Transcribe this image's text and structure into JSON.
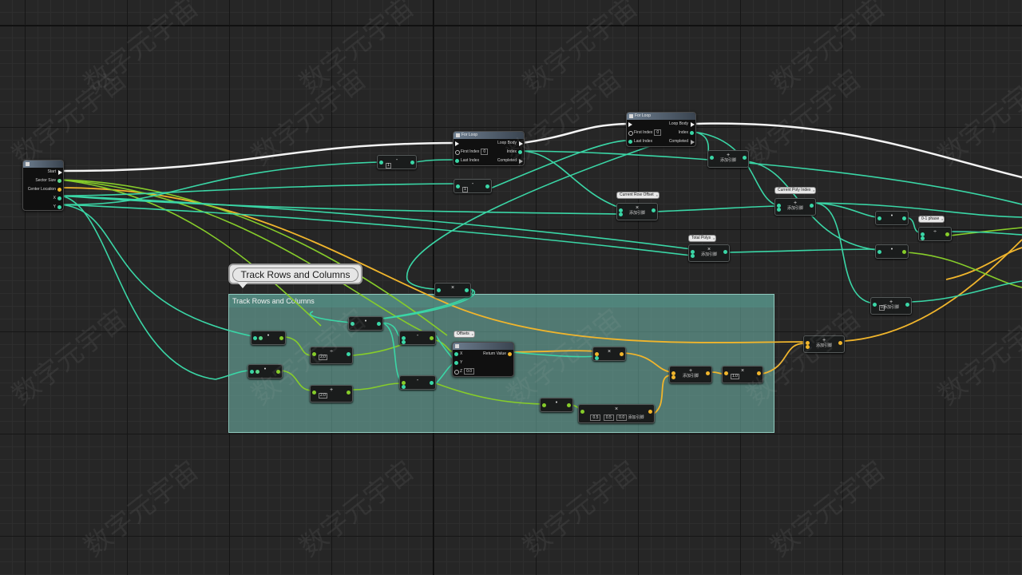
{
  "comment": {
    "bubble_text": "Track Rows and Columns",
    "box_title": "Track Rows and Columns"
  },
  "entry_node": {
    "title": "",
    "pins": [
      "Start",
      "Sector Size",
      "Center Location",
      "X",
      "Y"
    ]
  },
  "for_loop_1": {
    "title": "For Loop",
    "inputs": [
      "First Index",
      "Last Index"
    ],
    "first_index_value": "0",
    "outputs": [
      "Loop Body",
      "Index",
      "Completed"
    ]
  },
  "for_loop_2": {
    "title": "For Loop",
    "inputs": [
      "First Index",
      "Last Index"
    ],
    "first_index_value": "0",
    "outputs": [
      "Loop Body",
      "Index",
      "Completed"
    ]
  },
  "make_vector": {
    "title": "",
    "inputs": [
      "X",
      "Y",
      "Z"
    ],
    "z_value": "0.0",
    "output": "Return Value"
  },
  "variables": {
    "current_row_offset": "Current Row Offset",
    "current_poly_index": "Current Poly Index",
    "total_polys": "Total Polys",
    "phase": "0-1 phase",
    "offsets": "Offsets"
  },
  "math_nodes": {
    "add_label": "添加引脚",
    "vec_literals": [
      "0.5",
      "0.5",
      "0.0"
    ],
    "lit_1": "1",
    "lit_0": "0",
    "lit_2a": "2.0",
    "lit_2b": "2.0",
    "lit_1_0": "1.0",
    "lit_0_b": "0"
  },
  "colors": {
    "exec_wire": "#f4f4f4",
    "float_wire": "#3ad6a6",
    "int_wire": "#5cd68a",
    "vector_wire": "#f0b52c",
    "green_wire": "#86cc2a",
    "comment_fill": "#74beb0"
  },
  "watermark": {
    "text": "数字元宇宙"
  }
}
